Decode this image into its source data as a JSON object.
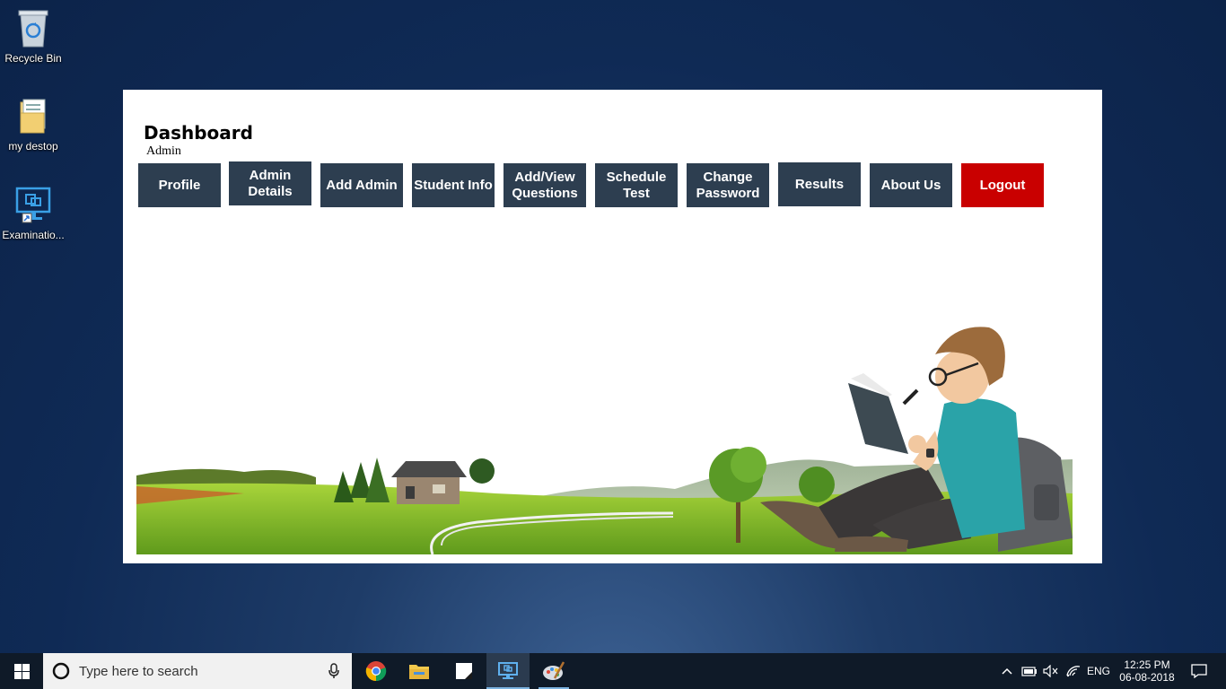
{
  "desktop": {
    "icons": [
      {
        "label": "Recycle Bin"
      },
      {
        "label": "my destop"
      },
      {
        "label": "Examinatio..."
      }
    ]
  },
  "window": {
    "title": "Dashboard",
    "role": "Admin",
    "nav": [
      {
        "label": "Profile"
      },
      {
        "label": "Admin Details"
      },
      {
        "label": "Add Admin"
      },
      {
        "label": "Student Info"
      },
      {
        "label": "Add/View Questions"
      },
      {
        "label": "Schedule Test"
      },
      {
        "label": "Change Password"
      },
      {
        "label": "Results"
      },
      {
        "label": "About Us"
      },
      {
        "label": "Logout"
      }
    ]
  },
  "taskbar": {
    "search_placeholder": "Type here to search",
    "language": "ENG",
    "time": "12:25 PM",
    "date": "06-08-2018"
  },
  "colors": {
    "nav_button": "#2d3e50",
    "logout_button": "#c90000",
    "desktop_bg": "#0f2a55"
  }
}
